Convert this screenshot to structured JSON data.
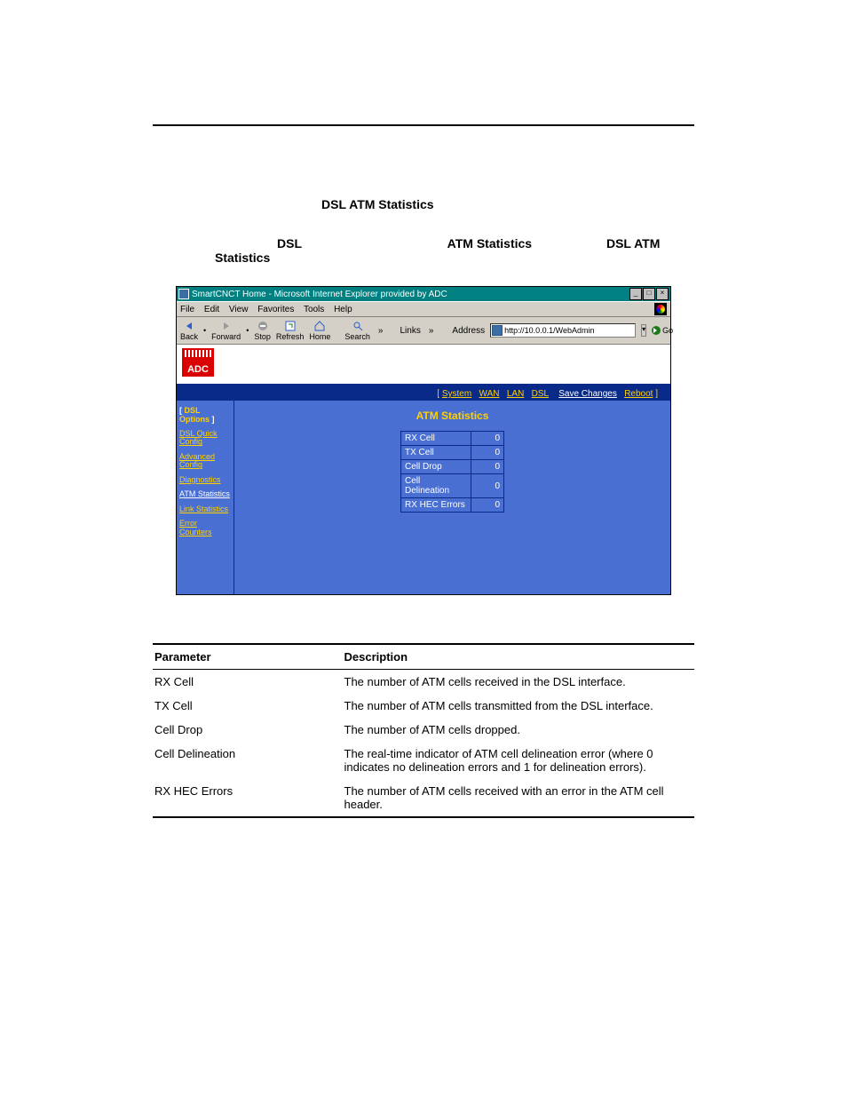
{
  "section_title": "DSL ATM Statistics",
  "intro": {
    "frag1": "DSL",
    "frag2": "ATM Statistics",
    "frag3": "DSL ATM Statistics"
  },
  "ie": {
    "title": "SmartCNCT Home - Microsoft Internet Explorer provided by ADC",
    "menus": [
      "File",
      "Edit",
      "View",
      "Favorites",
      "Tools",
      "Help"
    ],
    "toolbar": {
      "back": "Back",
      "forward": "Forward",
      "stop": "Stop",
      "refresh": "Refresh",
      "home": "Home",
      "search": "Search"
    },
    "links_label": "Links",
    "address_label": "Address",
    "address_value": "http://10.0.0.1/WebAdmin",
    "go": "Go"
  },
  "adc": {
    "logo": "ADC"
  },
  "nav": {
    "open": "[ ",
    "items": [
      "System",
      "WAN",
      "LAN",
      "DSL"
    ],
    "save": "Save Changes",
    "reboot": "Reboot",
    "close": " ]"
  },
  "sidebar": {
    "head_open": "[ ",
    "head_dsl": "DSL",
    "head_options": "Options",
    "head_close": " ]",
    "items": [
      {
        "label": "DSL Quick Config",
        "active": false
      },
      {
        "label": "Advanced Config",
        "active": false
      },
      {
        "label": "Diagnostics",
        "active": false
      },
      {
        "label": "ATM Statistics",
        "active": true
      },
      {
        "label": "Link Statistics",
        "active": false
      },
      {
        "label": "Error Counters",
        "active": false
      }
    ]
  },
  "panel": {
    "title": "ATM Statistics",
    "rows": [
      {
        "label": "RX Cell",
        "value": "0"
      },
      {
        "label": "TX Cell",
        "value": "0"
      },
      {
        "label": "Cell Drop",
        "value": "0"
      },
      {
        "label": "Cell Delineation",
        "value": "0"
      },
      {
        "label": "RX HEC Errors",
        "value": "0"
      }
    ]
  },
  "param_table": {
    "headers": {
      "param": "Parameter",
      "desc": "Description"
    },
    "rows": [
      {
        "param": "RX Cell",
        "desc": "The number of ATM cells received in the DSL interface."
      },
      {
        "param": "TX Cell",
        "desc": "The number of ATM cells transmitted from the DSL interface."
      },
      {
        "param": "Cell Drop",
        "desc": "The number of ATM cells dropped."
      },
      {
        "param": "Cell Delineation",
        "desc": "The real-time indicator of ATM cell delineation error (where 0 indicates no delineation errors and 1 for delineation errors)."
      },
      {
        "param": "RX HEC Errors",
        "desc": "The number of ATM cells received with an error in the ATM cell header."
      }
    ]
  }
}
